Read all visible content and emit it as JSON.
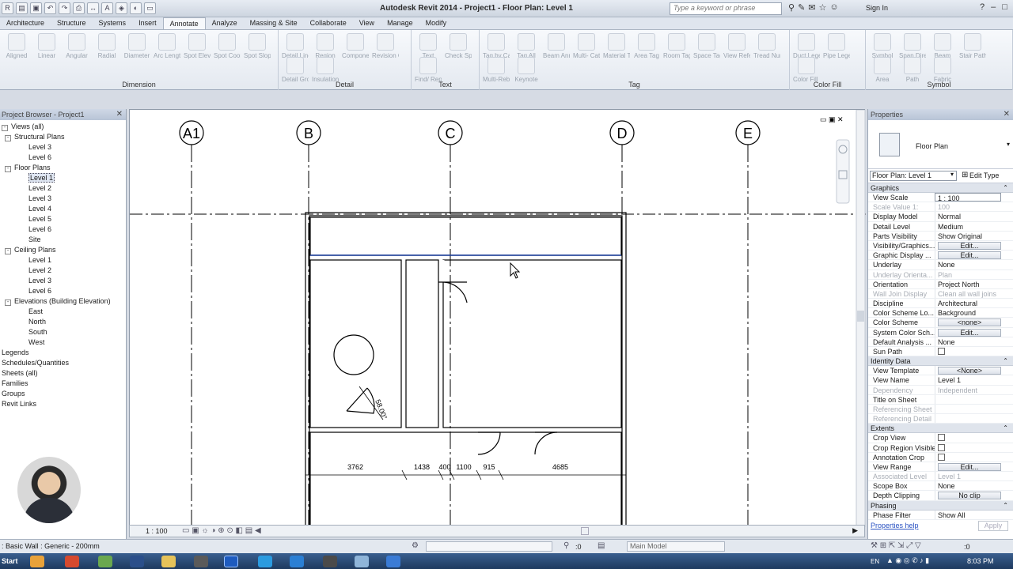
{
  "window": {
    "title": "Autodesk Revit 2014 -   Project1 - Floor Plan: Level 1",
    "search_placeholder": "Type a keyword or phrase",
    "signin": "Sign In"
  },
  "menu_tabs": [
    "Architecture",
    "Structure",
    "Systems",
    "Insert",
    "Annotate",
    "Analyze",
    "Massing & Site",
    "Collaborate",
    "View",
    "Manage",
    "Modify"
  ],
  "active_tab": "Annotate",
  "ribbon": {
    "panels": [
      {
        "title": "Dimension",
        "tools": [
          "Aligned",
          "Linear",
          "Angular",
          "Radial",
          "Diameter",
          "Arc Length",
          "Spot Elevation",
          "Spot Coordinate",
          "Spot Slope"
        ]
      },
      {
        "title": "Detail",
        "tools": [
          "Detail Line",
          "Region",
          "Component",
          "Revision Cloud",
          "Detail Group",
          "Insulation"
        ]
      },
      {
        "title": "Text",
        "tools": [
          "Text",
          "Check Spelling",
          "Find/ Replace"
        ]
      },
      {
        "title": "Tag",
        "tools": [
          "Tag by Category",
          "Tag All",
          "Beam Annotations",
          "Multi- Category",
          "Material Tag",
          "Area Tag",
          "Room Tag",
          "Space Tag",
          "View Reference",
          "Tread Number",
          "Multi-Rebar",
          "Keynote"
        ]
      },
      {
        "title": "Color Fill",
        "tools": [
          "Duct Legend",
          "Pipe Legend",
          "Color Fill Legend"
        ]
      },
      {
        "title": "Symbol",
        "tools": [
          "Symbol",
          "Span Direction",
          "Beam",
          "Stair Path",
          "Area",
          "Path",
          "Fabric"
        ]
      }
    ]
  },
  "project_browser": {
    "title": "Project Browser - Project1",
    "items": [
      {
        "label": "Views (all)",
        "level": 0,
        "exp": "-"
      },
      {
        "label": "Structural Plans",
        "level": 1,
        "exp": "-"
      },
      {
        "label": "Level 3",
        "level": 2
      },
      {
        "label": "Level 6",
        "level": 2
      },
      {
        "label": "Floor Plans",
        "level": 1,
        "exp": "-"
      },
      {
        "label": "Level 1",
        "level": 2,
        "selected": true
      },
      {
        "label": "Level 2",
        "level": 2
      },
      {
        "label": "Level 3",
        "level": 2
      },
      {
        "label": "Level 4",
        "level": 2
      },
      {
        "label": "Level 5",
        "level": 2
      },
      {
        "label": "Level 6",
        "level": 2
      },
      {
        "label": "Site",
        "level": 2
      },
      {
        "label": "Ceiling Plans",
        "level": 1,
        "exp": "-"
      },
      {
        "label": "Level 1",
        "level": 2
      },
      {
        "label": "Level 2",
        "level": 2
      },
      {
        "label": "Level 3",
        "level": 2
      },
      {
        "label": "Level 6",
        "level": 2
      },
      {
        "label": "Elevations (Building Elevation)",
        "level": 1,
        "exp": "-"
      },
      {
        "label": "East",
        "level": 2
      },
      {
        "label": "North",
        "level": 2
      },
      {
        "label": "South",
        "level": 2
      },
      {
        "label": "West",
        "level": 2
      },
      {
        "label": "Legends",
        "level": 0
      },
      {
        "label": "Schedules/Quantities",
        "level": 0
      },
      {
        "label": "Sheets (all)",
        "level": 0
      },
      {
        "label": "Families",
        "level": 0
      },
      {
        "label": "Groups",
        "level": 0
      },
      {
        "label": "Revit Links",
        "level": 0
      }
    ]
  },
  "drawing": {
    "grids": [
      "A1",
      "B",
      "C",
      "D",
      "E"
    ],
    "dimensions": [
      "3762",
      "1438",
      "400",
      "1100",
      "915",
      "4685"
    ],
    "angle_label": "58.00°",
    "view_scale": "1 : 100"
  },
  "properties": {
    "title": "Properties",
    "type_name": "Floor Plan",
    "instance": "Floor Plan: Level 1",
    "edit_type": "Edit Type",
    "sections": [
      {
        "name": "Graphics",
        "rows": [
          {
            "k": "View Scale",
            "v": "1 : 100",
            "input": true
          },
          {
            "k": "Scale Value    1:",
            "v": "100",
            "dim": true
          },
          {
            "k": "Display Model",
            "v": "Normal"
          },
          {
            "k": "Detail Level",
            "v": "Medium"
          },
          {
            "k": "Parts Visibility",
            "v": "Show Original"
          },
          {
            "k": "Visibility/Graphics...",
            "v": "Edit...",
            "btn": true
          },
          {
            "k": "Graphic Display ...",
            "v": "Edit...",
            "btn": true
          },
          {
            "k": "Underlay",
            "v": "None"
          },
          {
            "k": "Underlay Orienta...",
            "v": "Plan",
            "dim": true
          },
          {
            "k": "Orientation",
            "v": "Project North"
          },
          {
            "k": "Wall Join Display",
            "v": "Clean all wall joins",
            "dim": true
          },
          {
            "k": "Discipline",
            "v": "Architectural"
          },
          {
            "k": "Color Scheme Lo...",
            "v": "Background"
          },
          {
            "k": "Color Scheme",
            "v": "<none>",
            "btn": true
          },
          {
            "k": "System Color Sch...",
            "v": "Edit...",
            "btn": true
          },
          {
            "k": "Default Analysis ...",
            "v": "None"
          },
          {
            "k": "Sun Path",
            "v": "",
            "check": true
          }
        ]
      },
      {
        "name": "Identity Data",
        "rows": [
          {
            "k": "View Template",
            "v": "<None>",
            "btn": true
          },
          {
            "k": "View Name",
            "v": "Level 1"
          },
          {
            "k": "Dependency",
            "v": "Independent",
            "dim": true
          },
          {
            "k": "Title on Sheet",
            "v": ""
          },
          {
            "k": "Referencing Sheet",
            "v": "",
            "dim": true
          },
          {
            "k": "Referencing Detail",
            "v": "",
            "dim": true
          }
        ]
      },
      {
        "name": "Extents",
        "rows": [
          {
            "k": "Crop View",
            "v": "",
            "check": true
          },
          {
            "k": "Crop Region Visible",
            "v": "",
            "check": true
          },
          {
            "k": "Annotation Crop",
            "v": "",
            "check": true
          },
          {
            "k": "View Range",
            "v": "Edit...",
            "btn": true
          },
          {
            "k": "Associated Level",
            "v": "Level 1",
            "dim": true
          },
          {
            "k": "Scope Box",
            "v": "None"
          },
          {
            "k": "Depth Clipping",
            "v": "No clip",
            "btn": true
          }
        ]
      },
      {
        "name": "Phasing",
        "rows": [
          {
            "k": "Phase Filter",
            "v": "Show All"
          }
        ]
      }
    ],
    "help": "Properties help",
    "apply": "Apply"
  },
  "status": {
    "text": ": Basic Wall : Generic - 200mm",
    "zero": ":0",
    "workset": "Main Model",
    "right_zero": ":0"
  },
  "taskbar": {
    "start": "Start",
    "lang": "EN",
    "time": "8:03 PM"
  }
}
